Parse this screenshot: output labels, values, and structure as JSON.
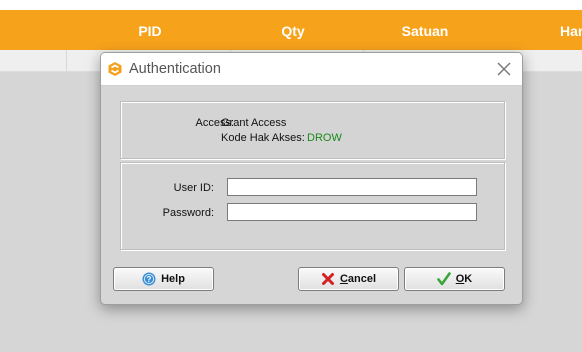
{
  "table": {
    "columns": [
      "PID",
      "Qty",
      "Satuan",
      "Har"
    ]
  },
  "dialog": {
    "title": "Authentication",
    "access_label": "Access:",
    "access_value": "Grant Access",
    "code_label": "Kode Hak Akses:",
    "code_value": "DROW",
    "user_id_label": "User ID:",
    "user_id_value": "",
    "password_label": "Password:",
    "password_value": "",
    "buttons": {
      "help_label": "Help",
      "cancel_prefix": "C",
      "cancel_rest": "ancel",
      "ok_prefix": "O",
      "ok_rest": "K"
    }
  },
  "colors": {
    "header_orange": "#f7a21b",
    "code_green": "#1a8a1a",
    "help_icon_blue": "#3b8fd6",
    "cancel_icon_red": "#d32020",
    "ok_icon_green": "#3aa63a"
  },
  "icons": {
    "app": "app-logo-icon",
    "close": "close-icon",
    "help": "help-icon",
    "cancel": "cancel-x-icon",
    "ok": "checkmark-icon"
  }
}
